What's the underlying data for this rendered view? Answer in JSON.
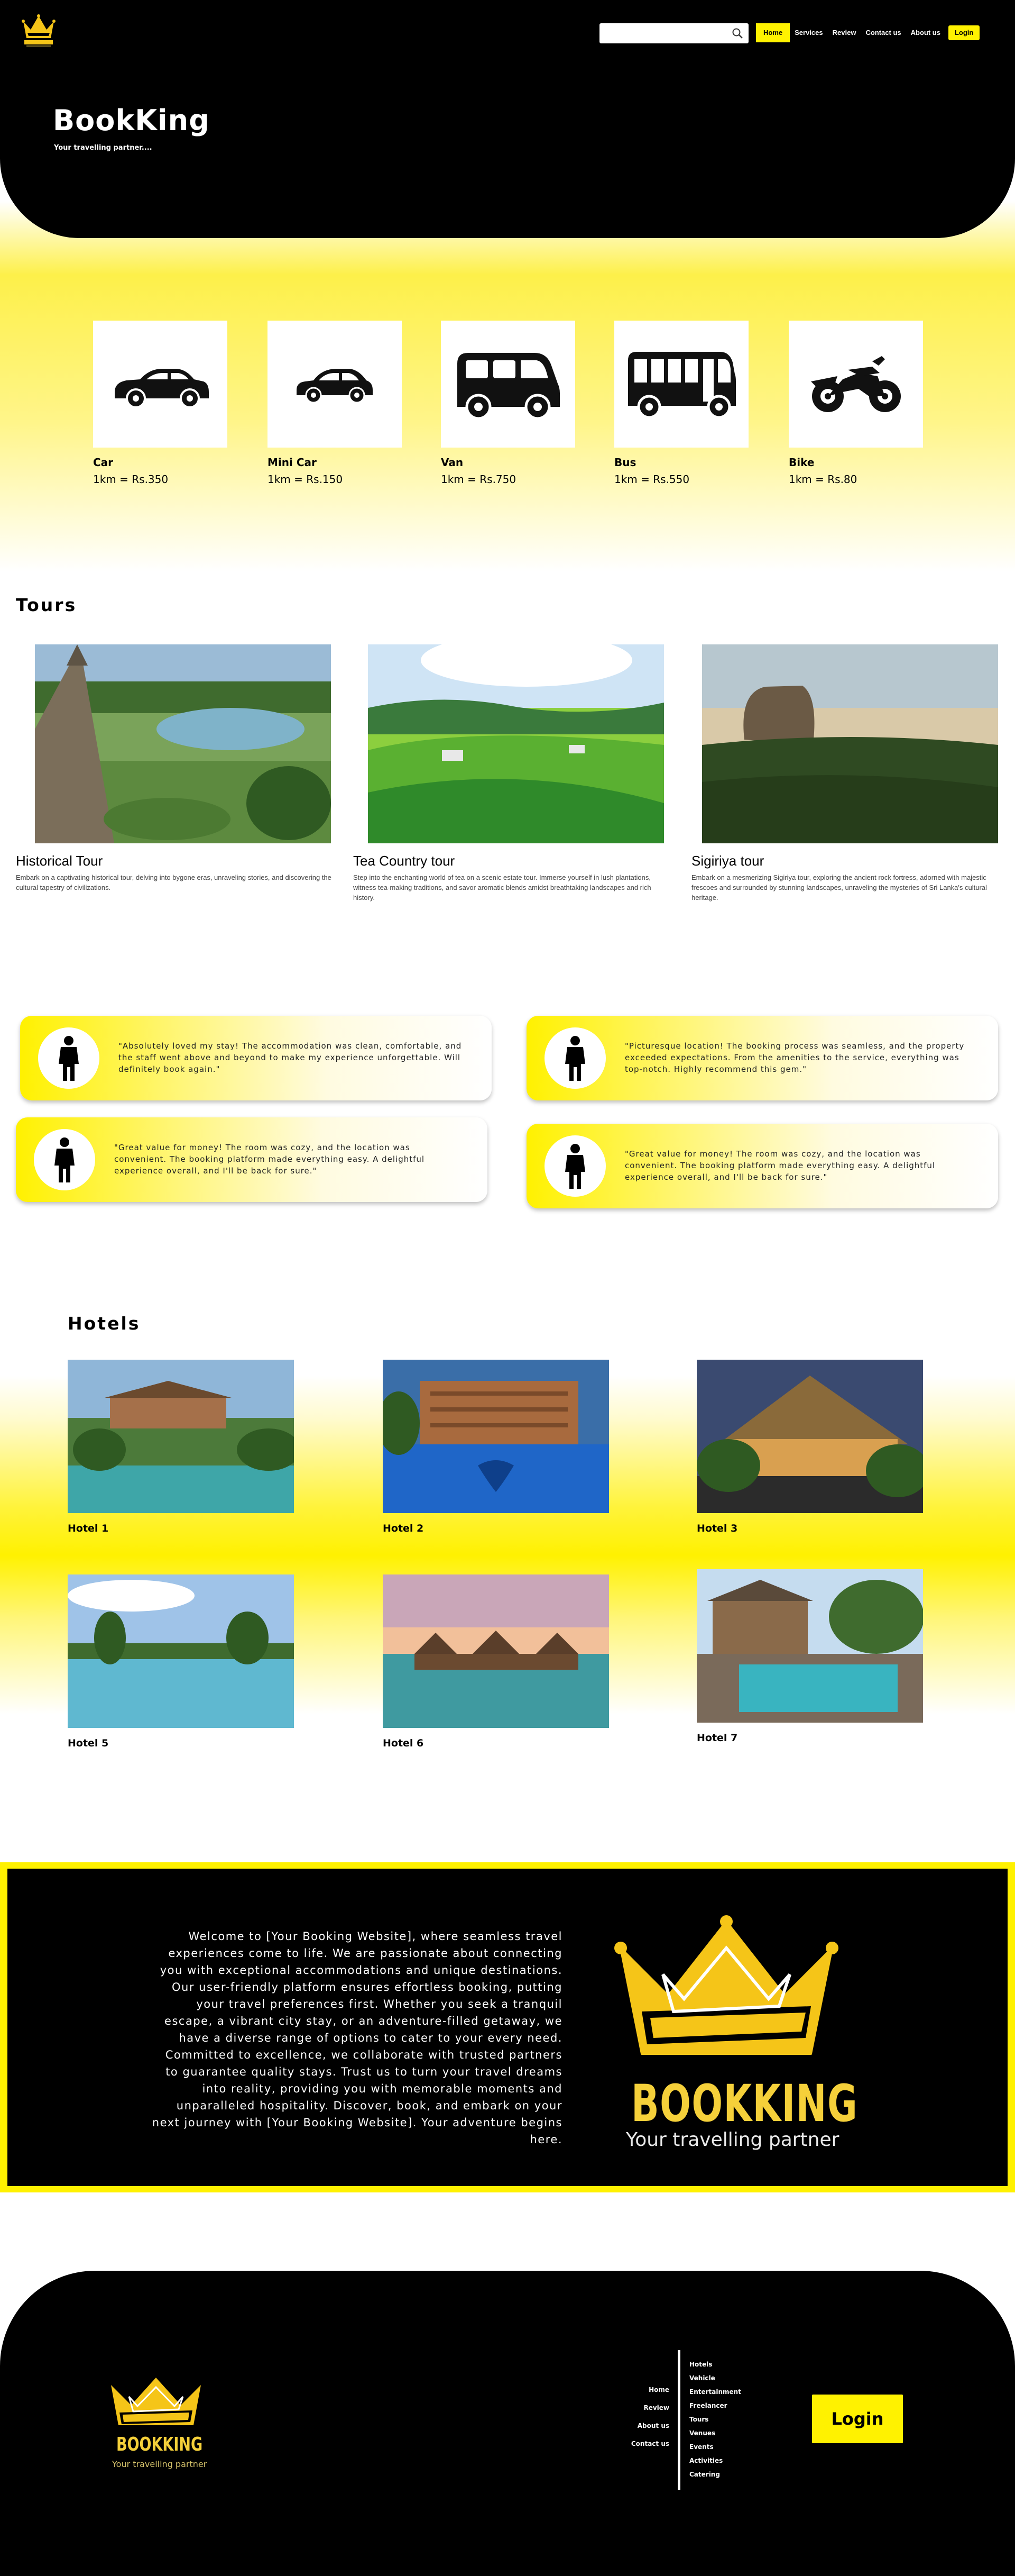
{
  "header": {
    "search_placeholder": "",
    "nav": [
      "Home",
      "Services",
      "Review",
      "Contact us",
      "About us"
    ],
    "login": "Login",
    "title": "BookKing",
    "subtitle": "Your travelling partner...."
  },
  "vehicles": [
    {
      "name": "Car",
      "price": "1km = Rs.350",
      "icon": "car-icon"
    },
    {
      "name": "Mini Car",
      "price": "1km = Rs.150",
      "icon": "mini-car-icon"
    },
    {
      "name": "Van",
      "price": "1km = Rs.750",
      "icon": "van-icon"
    },
    {
      "name": "Bus",
      "price": "1km = Rs.550",
      "icon": "bus-icon"
    },
    {
      "name": "Bike",
      "price": "1km = Rs.80",
      "icon": "bike-icon"
    }
  ],
  "tours": {
    "title": "Tours",
    "items": [
      {
        "name": "Historical Tour",
        "desc": "Embark on a captivating historical tour, delving into bygone eras, unraveling stories, and discovering the cultural tapestry of civilizations."
      },
      {
        "name": "Tea Country tour",
        "desc": "Step into the enchanting world of tea on a scenic estate tour. Immerse yourself in lush plantations, witness tea-making traditions, and savor aromatic blends amidst breathtaking landscapes and rich history."
      },
      {
        "name": "Sigiriya tour",
        "desc": "Embark on a mesmerizing Sigiriya tour, exploring the ancient rock fortress, adorned with majestic frescoes and surrounded by stunning landscapes, unraveling the mysteries of Sri Lanka's cultural heritage."
      }
    ]
  },
  "reviews": [
    "\"Absolutely loved my stay! The accommodation was clean, comfortable, and the staff went above and beyond to make my experience unforgettable. Will definitely book again.\"",
    "\"Picturesque location! The booking process was seamless, and the property exceeded expectations. From the amenities to the service, everything was top-notch. Highly recommend this gem.\"",
    "\"Great value for money! The room was cozy, and the location was convenient. The booking platform made everything easy. A delightful experience overall, and I'll be back for sure.\"",
    "\"Great value for money! The room was cozy, and the location was convenient. The booking platform made everything easy. A delightful experience overall, and I'll be back for sure.\""
  ],
  "hotels": {
    "title": "Hotels",
    "items": [
      "Hotel 1",
      "Hotel 2",
      "Hotel 3",
      "Hotel 5",
      "Hotel 6",
      "Hotel 7"
    ]
  },
  "about": {
    "text": "Welcome to [Your Booking Website], where seamless travel experiences come to life. We are passionate about connecting you with exceptional accommodations and unique destinations. Our user-friendly platform ensures effortless booking, putting your travel preferences first. Whether you seek a tranquil escape, a vibrant city stay, or an adventure-filled getaway, we have a diverse range of options to cater to your every need. Committed to excellence, we collaborate with trusted partners to guarantee quality stays. Trust us to turn your travel dreams into reality, providing you with memorable moments and unparalleled hospitality. Discover, book, and embark on your next journey with [Your Booking Website]. Your adventure begins here.",
    "brand": "BOOKKING",
    "tagline": "Your travelling partner"
  },
  "footer": {
    "brand": "BOOKKING",
    "tagline": "Your travelling partner",
    "left_links": [
      "Home",
      "Review",
      "About us",
      "Contact us"
    ],
    "right_links": [
      "Hotels",
      "Vehicle",
      "Entertainment",
      "Freelancer",
      "Tours",
      "Venues",
      "Events",
      "Activities",
      "Catering"
    ],
    "login": "Login"
  },
  "colors": {
    "accent": "#fff200",
    "dark": "#000000",
    "gold": "#f5d03a"
  }
}
